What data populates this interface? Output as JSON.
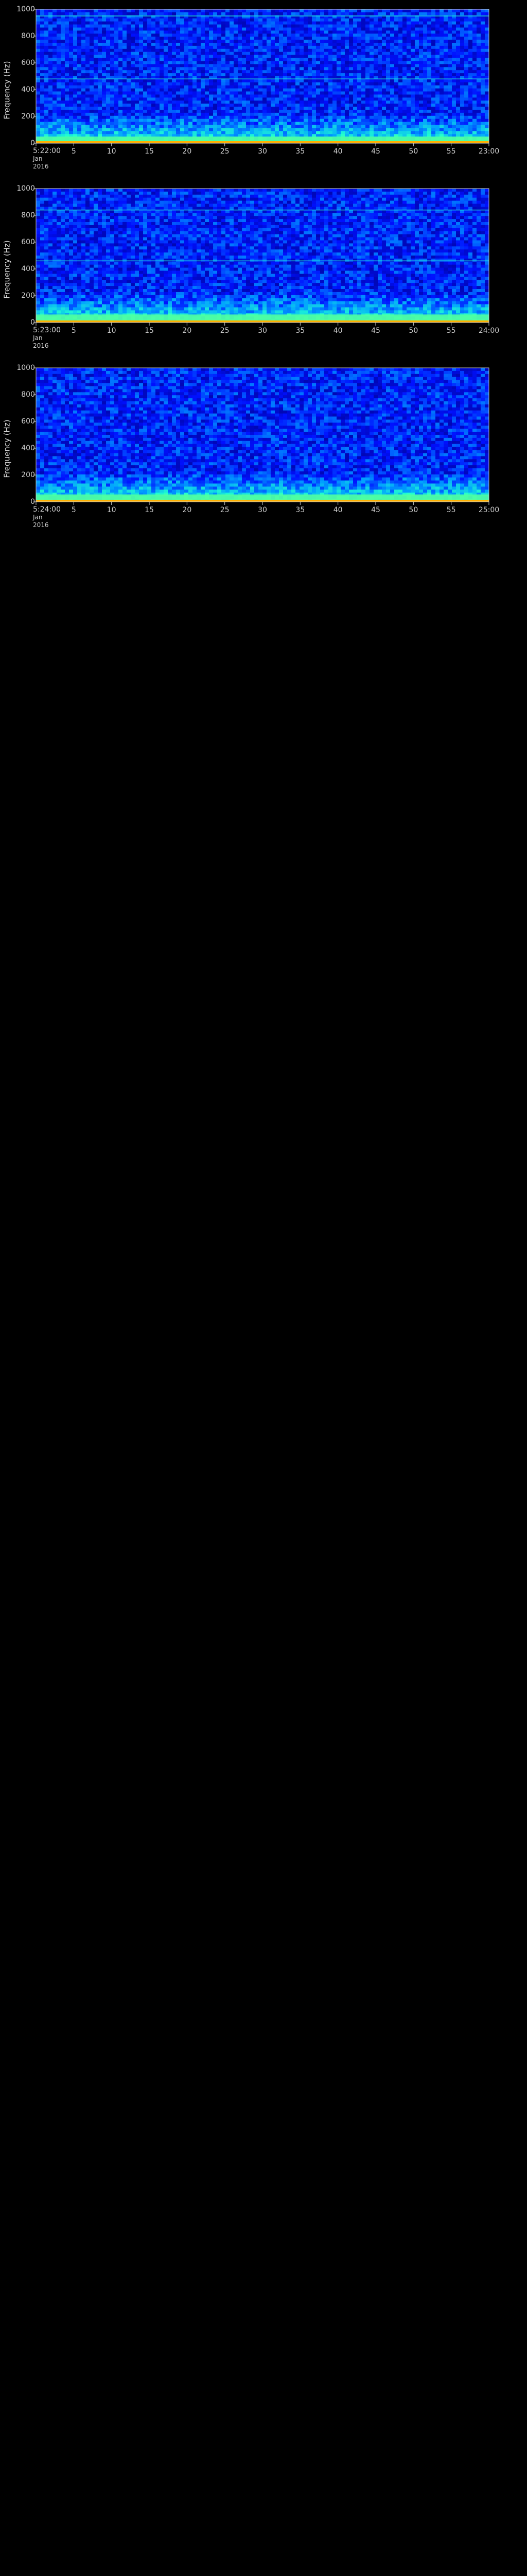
{
  "chart_data": [
    {
      "type": "heatmap",
      "ylabel": "Frequency (Hz)",
      "yticks": [
        "0",
        "200",
        "400",
        "600",
        "800",
        "1000"
      ],
      "ylim": [
        0,
        1000
      ],
      "x_start_label": "5:22:00",
      "x_start_sub": [
        "Jan",
        "2016"
      ],
      "xticks": [
        "5",
        "10",
        "15",
        "20",
        "25",
        "30",
        "35",
        "40",
        "45",
        "50",
        "55",
        "23:00"
      ],
      "colormap": [
        "#00007f",
        "#0010ff",
        "#00a0ff",
        "#20ffd0",
        "#c0ff30",
        "#ffb000",
        "#ff2000"
      ],
      "noise_floor_hz": 50,
      "tonal_lines_hz": [
        480,
        950
      ],
      "vertical_transients_min": []
    },
    {
      "type": "heatmap",
      "ylabel": "Frequency (Hz)",
      "yticks": [
        "0",
        "200",
        "400",
        "600",
        "800",
        "1000"
      ],
      "ylim": [
        0,
        1000
      ],
      "x_start_label": "5:23:00",
      "x_start_sub": [
        "Jan",
        "2016"
      ],
      "xticks": [
        "5",
        "10",
        "15",
        "20",
        "25",
        "30",
        "35",
        "40",
        "45",
        "50",
        "55",
        "24:00"
      ],
      "colormap": [
        "#00007f",
        "#0010ff",
        "#00a0ff",
        "#20ffd0",
        "#c0ff30",
        "#ffb000",
        "#ff2000"
      ],
      "noise_floor_hz": 60,
      "tonal_lines_hz": [
        460,
        840
      ],
      "vertical_transients_min": []
    },
    {
      "type": "heatmap",
      "ylabel": "Frequency (Hz)",
      "yticks": [
        "0",
        "200",
        "400",
        "600",
        "800",
        "1000"
      ],
      "ylim": [
        0,
        1000
      ],
      "x_start_label": "5:24:00",
      "x_start_sub": [
        "Jan",
        "2016"
      ],
      "xticks": [
        "5",
        "10",
        "15",
        "20",
        "25",
        "30",
        "35",
        "40",
        "45",
        "50",
        "55",
        "25:00"
      ],
      "colormap": [
        "#00007f",
        "#0010ff",
        "#00a0ff",
        "#20ffd0",
        "#c0ff30",
        "#ffb000",
        "#ff2000"
      ],
      "noise_floor_hz": 55,
      "tonal_lines_hz": [],
      "vertical_transients_min": []
    }
  ]
}
